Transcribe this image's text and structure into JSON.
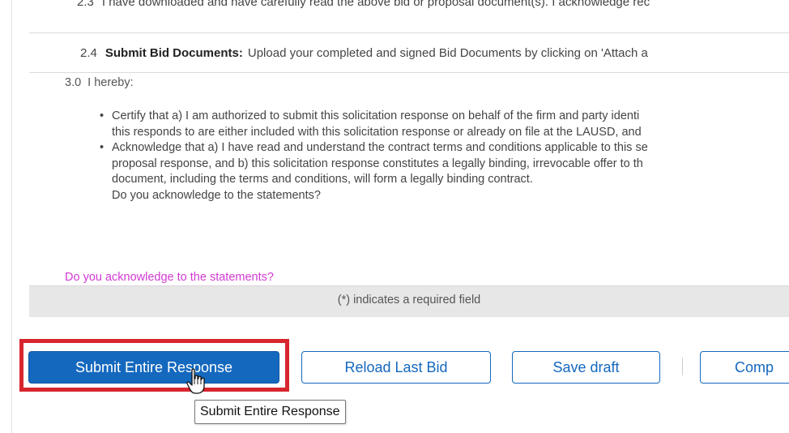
{
  "rows": {
    "item_2_3": {
      "number": "2.3",
      "text": "I have downloaded and have carefully read the above bid or proposal document(s). I acknowledge rec"
    },
    "item_2_4": {
      "number": "2.4",
      "title": "Submit Bid Documents:",
      "text": "Upload your completed and signed Bid Documents by clicking on 'Attach a"
    }
  },
  "section_3": {
    "number": "3.0",
    "heading": "I hereby:",
    "bullets": [
      {
        "lines": [
          "Certify that a) I am authorized to submit this solicitation response on behalf of the firm and party identi",
          "this responds to are either included with this solicitation response or already on file at the LAUSD, and"
        ]
      },
      {
        "lines": [
          "Acknowledge that a) I have read and understand the contract terms and conditions applicable to this se",
          "proposal response, and b) this solicitation response constitutes a legally binding, irrevocable offer to th",
          "document, including the terms and conditions, will form a legally binding contract."
        ]
      }
    ],
    "closing_question": "Do you acknowledge to the statements?"
  },
  "acknowledge_prompt": "Do you acknowledge to the statements?",
  "required_note": "(*) indicates a required field",
  "buttons": {
    "submit": "Submit Entire Response",
    "reload": "Reload Last Bid",
    "save": "Save draft",
    "compose": "Comp"
  },
  "tooltip": "Submit Entire Response",
  "colors": {
    "primary": "#1468be",
    "highlight": "#d7262e",
    "prompt_pink": "#d23ad2",
    "required_bar": "#e7e7e7"
  },
  "icons": {
    "bullet": "bullet-dot-icon",
    "cursor": "hand-pointer-cursor-icon"
  }
}
